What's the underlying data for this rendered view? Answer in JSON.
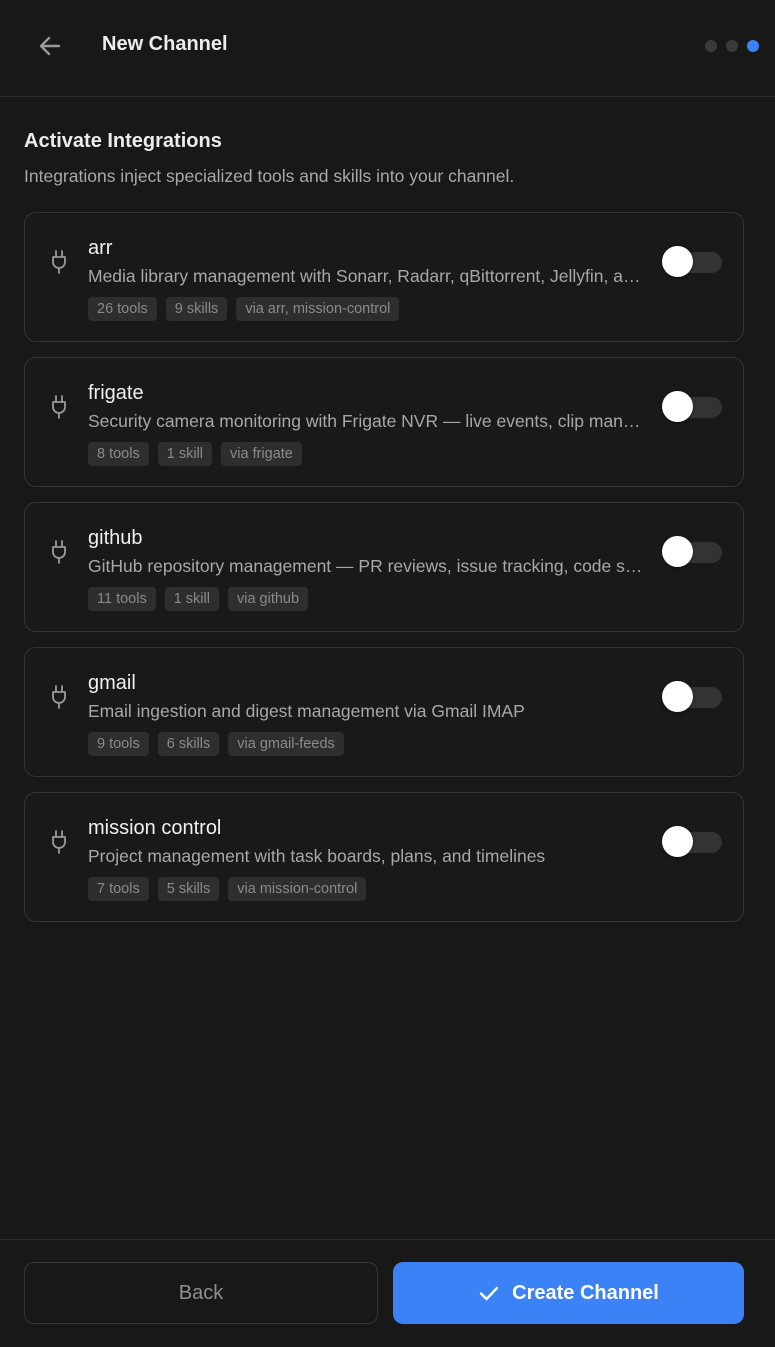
{
  "header": {
    "title": "New Channel",
    "steps": [
      {
        "state": "done"
      },
      {
        "state": "done"
      },
      {
        "state": "active"
      }
    ]
  },
  "section": {
    "title": "Activate Integrations",
    "subtitle": "Integrations inject specialized tools and skills into your channel."
  },
  "integrations": [
    {
      "name": "arr",
      "description": "Media library management with Sonarr, Radarr, qBittorrent, Jellyfin, and more",
      "tags": [
        "26 tools",
        "9 skills",
        "via arr, mission-control"
      ],
      "enabled": false
    },
    {
      "name": "frigate",
      "description": "Security camera monitoring with Frigate NVR — live events, clip management, and alerts",
      "tags": [
        "8 tools",
        "1 skill",
        "via frigate"
      ],
      "enabled": false
    },
    {
      "name": "github",
      "description": "GitHub repository management — PR reviews, issue tracking, code search",
      "tags": [
        "11 tools",
        "1 skill",
        "via github"
      ],
      "enabled": false
    },
    {
      "name": "gmail",
      "description": "Email ingestion and digest management via Gmail IMAP",
      "tags": [
        "9 tools",
        "6 skills",
        "via gmail-feeds"
      ],
      "enabled": false
    },
    {
      "name": "mission control",
      "description": "Project management with task boards, plans, and timelines",
      "tags": [
        "7 tools",
        "5 skills",
        "via mission-control"
      ],
      "enabled": false
    }
  ],
  "footer": {
    "back_label": "Back",
    "create_label": "Create Channel"
  },
  "colors": {
    "accent": "#3b82f6",
    "background": "#181818"
  },
  "icons": {
    "back": "arrow-left-icon",
    "integration": "plug-icon",
    "create": "check-icon"
  }
}
